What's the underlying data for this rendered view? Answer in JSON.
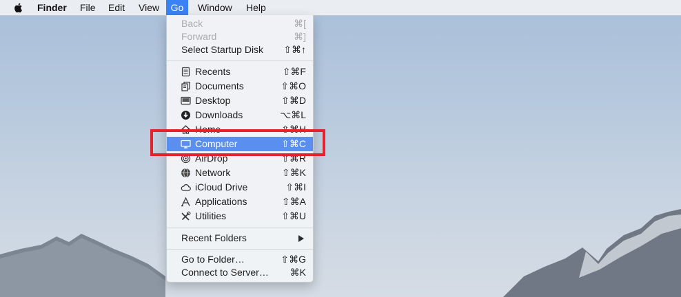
{
  "menubar": {
    "app_name": "Finder",
    "items": [
      "File",
      "Edit",
      "View",
      "Go",
      "Window",
      "Help"
    ],
    "active_item": "Go"
  },
  "go_menu": {
    "back": {
      "label": "Back",
      "shortcut": "⌘[",
      "enabled": false
    },
    "forward": {
      "label": "Forward",
      "shortcut": "⌘]",
      "enabled": false
    },
    "startup_disk": {
      "label": "Select Startup Disk",
      "shortcut": "⇧⌘↑"
    },
    "locations": [
      {
        "label": "Recents",
        "shortcut": "⇧⌘F",
        "icon": "recents-icon"
      },
      {
        "label": "Documents",
        "shortcut": "⇧⌘O",
        "icon": "documents-icon"
      },
      {
        "label": "Desktop",
        "shortcut": "⇧⌘D",
        "icon": "desktop-icon"
      },
      {
        "label": "Downloads",
        "shortcut": "⌥⌘L",
        "icon": "downloads-icon"
      },
      {
        "label": "Home",
        "shortcut": "⇧⌘H",
        "icon": "home-icon"
      },
      {
        "label": "Computer",
        "shortcut": "⇧⌘C",
        "icon": "computer-icon",
        "highlighted": true
      },
      {
        "label": "AirDrop",
        "shortcut": "⇧⌘R",
        "icon": "airdrop-icon"
      },
      {
        "label": "Network",
        "shortcut": "⇧⌘K",
        "icon": "network-icon"
      },
      {
        "label": "iCloud Drive",
        "shortcut": "⇧⌘I",
        "icon": "icloud-icon"
      },
      {
        "label": "Applications",
        "shortcut": "⇧⌘A",
        "icon": "applications-icon"
      },
      {
        "label": "Utilities",
        "shortcut": "⇧⌘U",
        "icon": "utilities-icon"
      }
    ],
    "recent_folders": {
      "label": "Recent Folders",
      "icon": "submenu-arrow-icon"
    },
    "go_to_folder": {
      "label": "Go to Folder…",
      "shortcut": "⇧⌘G"
    },
    "connect_to_server": {
      "label": "Connect to Server…",
      "shortcut": "⌘K"
    }
  },
  "colors": {
    "highlight": "#5a8ff0",
    "menubar_active": "#3b82f6",
    "annotation": "#e3222b"
  }
}
